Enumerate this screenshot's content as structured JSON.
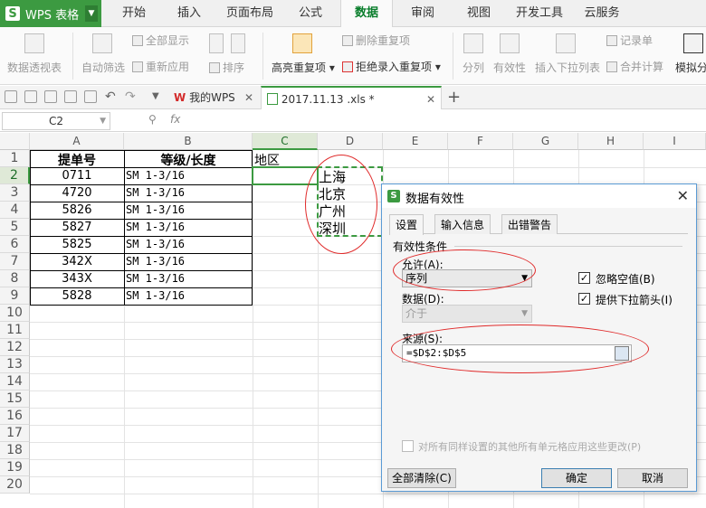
{
  "app": {
    "name": "WPS 表格",
    "logo": "S"
  },
  "menu": {
    "tabs": [
      "开始",
      "插入",
      "页面布局",
      "公式",
      "数据",
      "审阅",
      "视图",
      "开发工具",
      "云服务"
    ],
    "active": "数据"
  },
  "ribbon": {
    "pivot": "数据透视表",
    "autofilter": "自动筛选",
    "show_all": "全部显示",
    "reapply": "重新应用",
    "sort": "排序",
    "highlight_dup": "高亮重复项",
    "remove_dup": "删除重复项",
    "reject_dup": "拒绝录入重复项",
    "split": "分列",
    "validity": "有效性",
    "insert_dropdown": "插入下拉列表",
    "records": "记录单",
    "consolidate": "合并计算",
    "simulate": "模拟分"
  },
  "doctabs": {
    "home": "我的WPS",
    "file": "2017.11.13 .xls *",
    "add": "+"
  },
  "formula": {
    "cell_ref": "C2",
    "fx": "fx"
  },
  "grid": {
    "columns": [
      "A",
      "B",
      "C",
      "D",
      "E",
      "F",
      "G",
      "H",
      "I"
    ],
    "rows": [
      "1",
      "2",
      "3",
      "4",
      "5",
      "6",
      "7",
      "8",
      "9",
      "10",
      "11",
      "12",
      "13",
      "14",
      "15",
      "16",
      "17",
      "18",
      "19",
      "20"
    ],
    "headers": {
      "a": "提单号",
      "b": "等级/长度",
      "c": "地区"
    },
    "table_rows": [
      {
        "a": "0711",
        "b": "SM 1-3/16"
      },
      {
        "a": "4720",
        "b": "SM 1-3/16"
      },
      {
        "a": "5826",
        "b": "SM 1-3/16"
      },
      {
        "a": "5827",
        "b": "SM 1-3/16"
      },
      {
        "a": "5825",
        "b": "SM 1-3/16"
      },
      {
        "a": "342X",
        "b": "SM 1-3/16"
      },
      {
        "a": "343X",
        "b": "SM 1-3/16"
      },
      {
        "a": "5828",
        "b": "SM 1-3/16"
      }
    ],
    "cities": [
      "上海",
      "北京",
      "广州",
      "深圳"
    ]
  },
  "dialog": {
    "title": "数据有效性",
    "close": "✕",
    "tabs": [
      "设置",
      "输入信息",
      "出错警告"
    ],
    "group_label": "有效性条件",
    "allow_label": "允许(A):",
    "allow_value": "序列",
    "data_label": "数据(D):",
    "data_value": "介于",
    "ignore_blank": "忽略空值(B)",
    "dropdown_arrow": "提供下拉箭头(I)",
    "source_label": "来源(S):",
    "source_value": "=$D$2:$D$5",
    "apply_all": "对所有同样设置的其他所有单元格应用这些更改(P)",
    "clear_all": "全部清除(C)",
    "ok": "确定",
    "cancel": "取消"
  },
  "colors": {
    "brand": "#3c9a41",
    "annotation": "#e02b2b",
    "selection": "#3c9a41"
  }
}
